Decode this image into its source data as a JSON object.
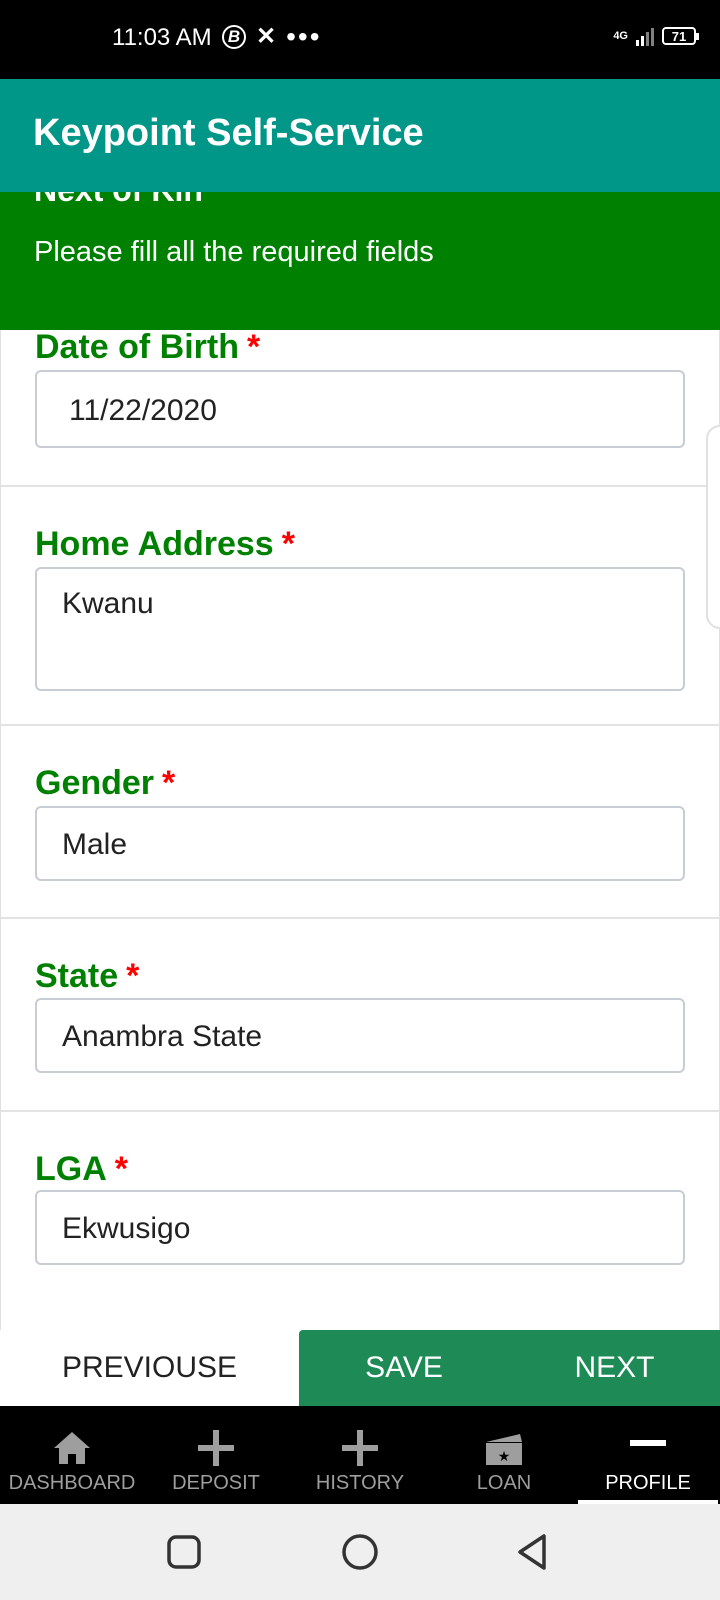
{
  "status_bar": {
    "time": "11:03 AM",
    "b_icon": "B",
    "dots": "•••",
    "network": "4G",
    "battery": "71"
  },
  "app_bar": {
    "title": "Keypoint Self-Service"
  },
  "banner": {
    "title": "Next of Kin",
    "note": "Please fill all the required fields"
  },
  "form": {
    "required_mark": "*",
    "date_of_birth": {
      "label": "Date of Birth",
      "value": "11/22/2020"
    },
    "home_address": {
      "label": "Home Address",
      "value": "Kwanu"
    },
    "gender": {
      "label": "Gender",
      "value": "Male"
    },
    "state": {
      "label": "State",
      "value": "Anambra State"
    },
    "lga": {
      "label": "LGA",
      "value": "Ekwusigo"
    }
  },
  "actions": {
    "previous": "PREVIOUSE",
    "save": "SAVE",
    "next": "NEXT"
  },
  "bottom_nav": {
    "items": [
      {
        "label": "DASHBOARD",
        "icon": "home-icon"
      },
      {
        "label": "DEPOSIT",
        "icon": "plus-icon"
      },
      {
        "label": "HISTORY",
        "icon": "plus-icon"
      },
      {
        "label": "LOAN",
        "icon": "card-star-icon"
      },
      {
        "label": "PROFILE",
        "icon": "minus-icon"
      }
    ],
    "active_index": 4
  },
  "colors": {
    "app_bar": "#009688",
    "banner": "#008000",
    "label": "#008000",
    "required": "#ff0000",
    "action_green": "#1e8b57"
  }
}
